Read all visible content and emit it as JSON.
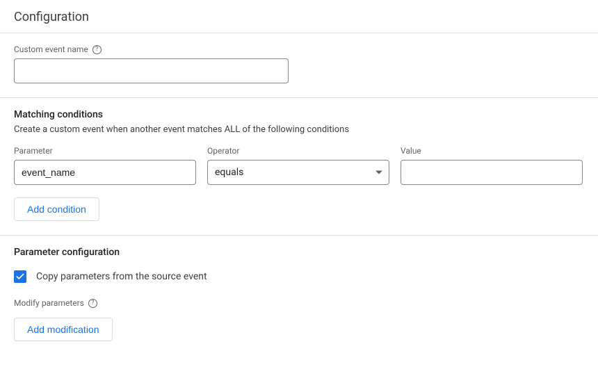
{
  "header": {
    "title": "Configuration"
  },
  "custom_event": {
    "label": "Custom event name",
    "value": ""
  },
  "matching": {
    "title": "Matching conditions",
    "description": "Create a custom event when another event matches ALL of the following conditions",
    "labels": {
      "parameter": "Parameter",
      "operator": "Operator",
      "value": "Value"
    },
    "row": {
      "parameter": "event_name",
      "operator": "equals",
      "value": ""
    },
    "add_btn": "Add condition"
  },
  "param_config": {
    "title": "Parameter configuration",
    "copy_label": "Copy parameters from the source event",
    "copy_checked": true,
    "modify_label": "Modify parameters",
    "add_btn": "Add modification"
  }
}
